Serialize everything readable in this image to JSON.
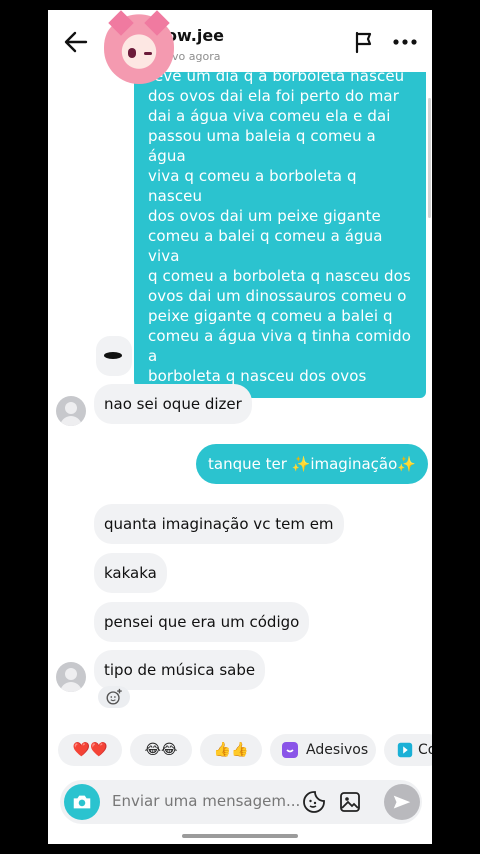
{
  "header": {
    "username": "ow.jee",
    "status": "vo agora"
  },
  "messages": {
    "long_out": "teve um dia q a borboleta nasceu\ndos ovos dai ela foi perto do mar\ndai a água viva comeu ela e dai\npassou uma baleia q comeu a água\nviva q comeu a borboleta q nasceu\ndos ovos dai um peixe gigante\ncomeu a balei q comeu a água viva\nq comeu a borboleta q nasceu dos\novos dai um dinossauros comeu o\npeixe gigante q comeu a balei q\ncomeu a água viva q tinha comido a\nborboleta q nasceu dos ovos",
    "in1": "nao sei oque dizer",
    "out2": "tanque ter ✨imaginação✨",
    "in2": "quanta imaginação vc tem em",
    "in3": "kakaka",
    "in4": "pensei que era um código",
    "in5": "tipo de música sabe"
  },
  "quick_replies": {
    "hearts": "❤️❤️",
    "laugh": "😂😂",
    "thumbs": "👍👍",
    "stickers": "Adesivos",
    "cut": "Co"
  },
  "composer": {
    "placeholder": "Enviar uma mensagem..."
  },
  "colors": {
    "outgoing": "#2bc3cf",
    "incoming": "#f1f2f4"
  }
}
